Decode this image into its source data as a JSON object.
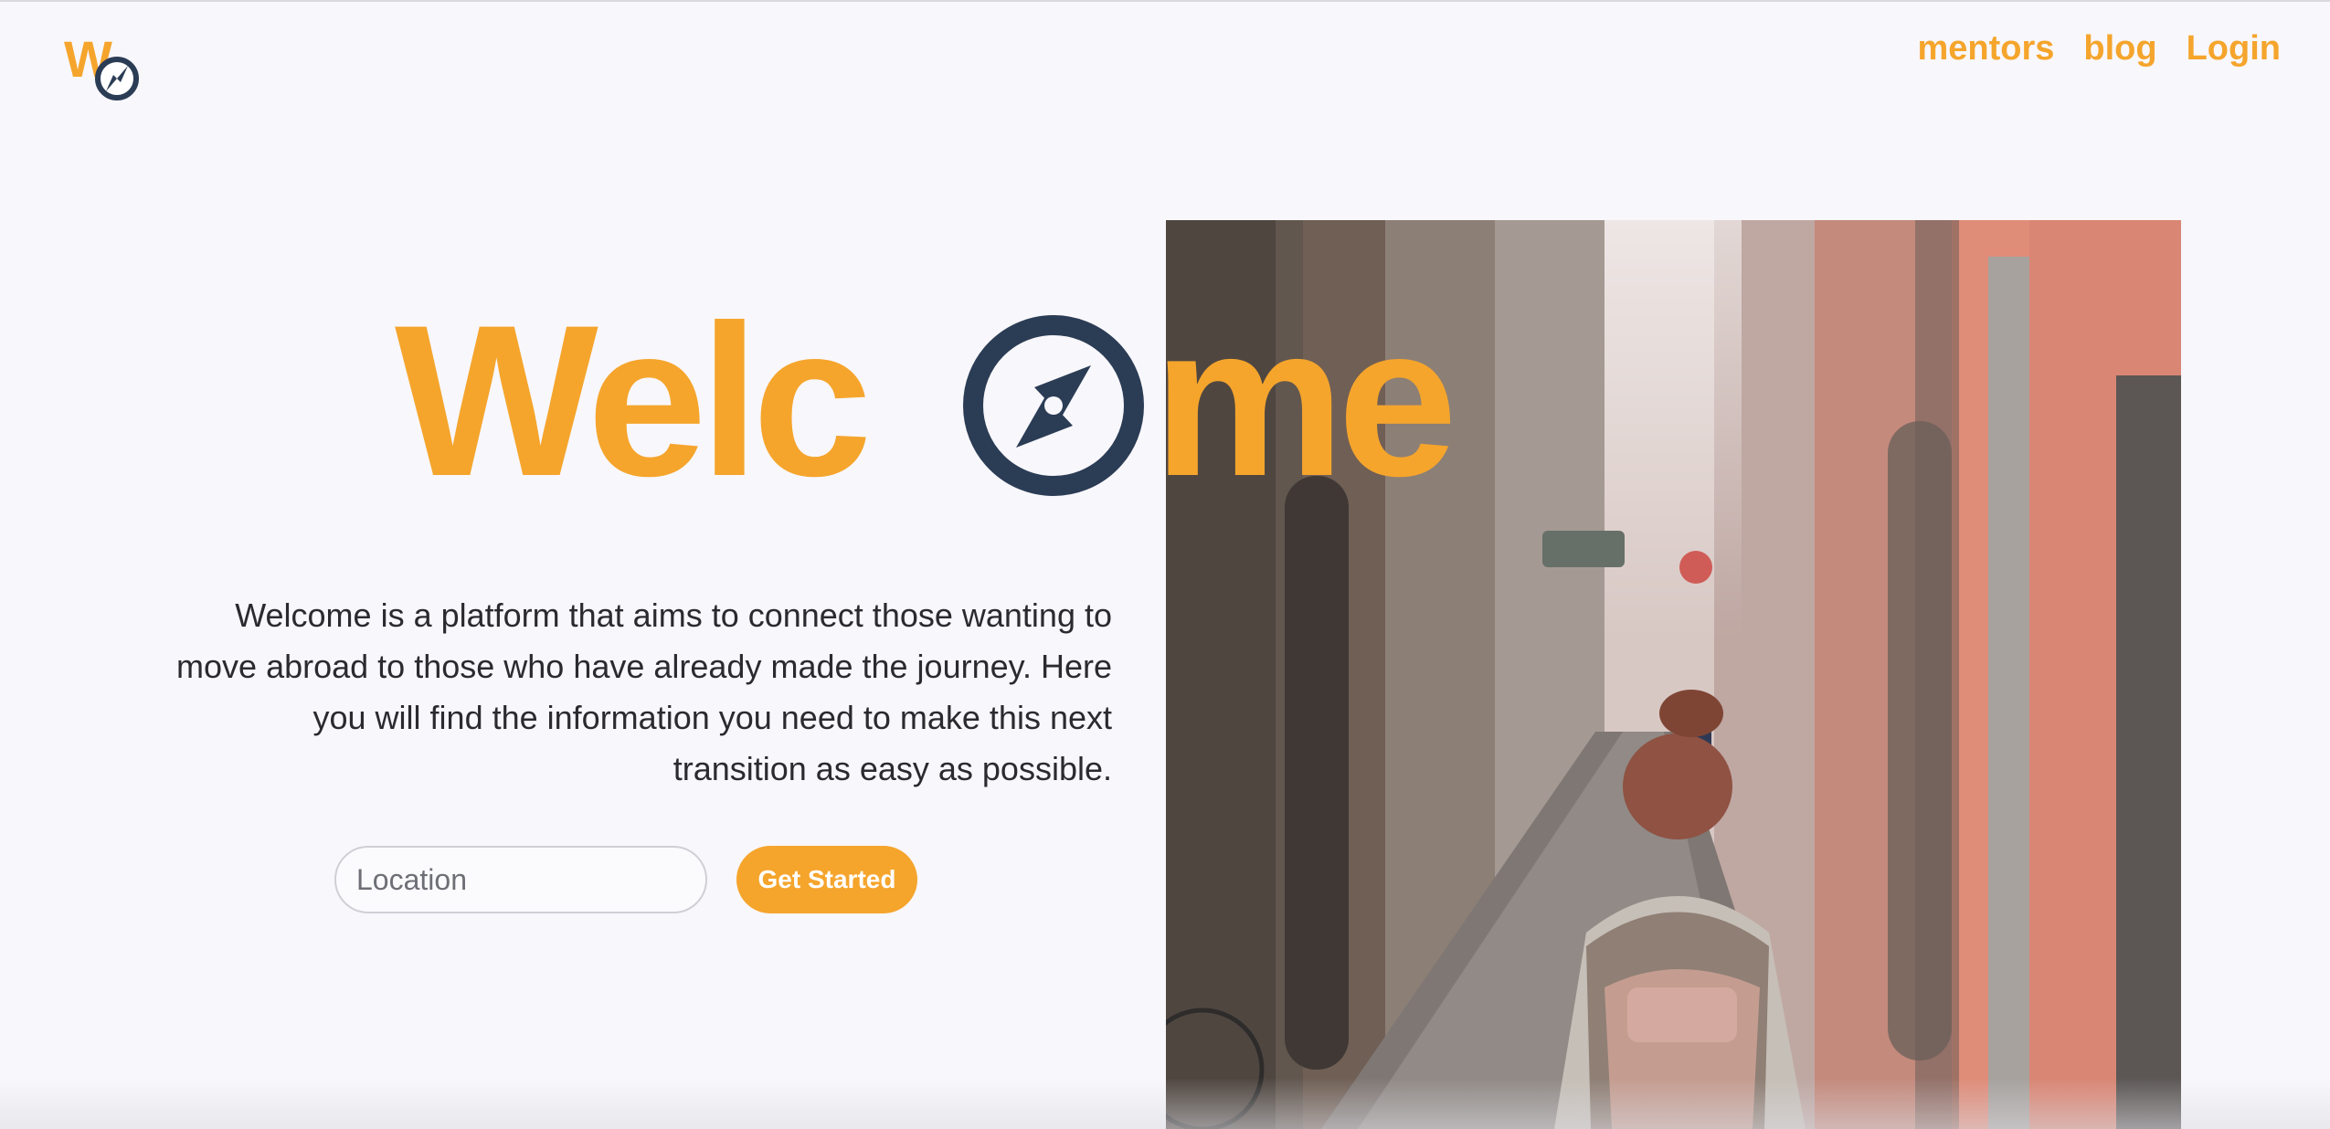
{
  "nav": {
    "items": [
      {
        "label": "mentors"
      },
      {
        "label": "blog"
      },
      {
        "label": "Login"
      }
    ]
  },
  "hero": {
    "title_left": "Welc",
    "title_right": "me",
    "description": "Welcome is a platform that aims to connect those wanting to move abroad to those who have already made the journey. Here you will find the information you need to make this next transition as easy as possible."
  },
  "search": {
    "placeholder": "Location",
    "value": ""
  },
  "cta": {
    "label": "Get Started"
  },
  "logo": {
    "letter": "W",
    "icon": "compass-icon"
  },
  "colors": {
    "accent": "#f5a52c",
    "navy": "#2b3c55",
    "background": "#f8f7fb"
  }
}
